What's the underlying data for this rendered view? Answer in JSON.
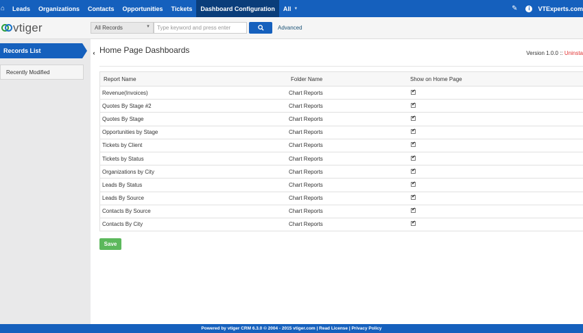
{
  "topnav": {
    "home_icon": "home-icon",
    "items": [
      {
        "label": "Leads"
      },
      {
        "label": "Organizations"
      },
      {
        "label": "Contacts"
      },
      {
        "label": "Opportunities"
      },
      {
        "label": "Tickets"
      },
      {
        "label": "Dashboard Configuration",
        "active": true
      },
      {
        "label": "All"
      }
    ],
    "user": "VTExperts.com",
    "accent": "#1560bd"
  },
  "header": {
    "logo_text": "vtiger",
    "filter_select": "All Records",
    "search_placeholder": "Type keyword and press enter",
    "advanced_label": "Advanced"
  },
  "sidebar": {
    "records_list": "Records List",
    "recently_modified": "Recently Modified"
  },
  "main": {
    "title": "Home Page Dashboards",
    "version_label": "Version 1.0.0 ::",
    "uninstall_label": "Uninsta",
    "table": {
      "headers": [
        "Report Name",
        "Folder Name",
        "Show on Home Page"
      ],
      "rows": [
        {
          "report": "Revenue(Invoices)",
          "folder": "Chart Reports",
          "show": true
        },
        {
          "report": "Quotes By Stage #2",
          "folder": "Chart Reports",
          "show": true
        },
        {
          "report": "Quotes By Stage",
          "folder": "Chart Reports",
          "show": true
        },
        {
          "report": "Opportunities by Stage",
          "folder": "Chart Reports",
          "show": true
        },
        {
          "report": "Tickets by Client",
          "folder": "Chart Reports",
          "show": true
        },
        {
          "report": "Tickets by Status",
          "folder": "Chart Reports",
          "show": true
        },
        {
          "report": "Organizations by City",
          "folder": "Chart Reports",
          "show": true
        },
        {
          "report": "Leads By Status",
          "folder": "Chart Reports",
          "show": true
        },
        {
          "report": "Leads By Source",
          "folder": "Chart Reports",
          "show": true
        },
        {
          "report": "Contacts By Source",
          "folder": "Chart Reports",
          "show": true
        },
        {
          "report": "Contacts By City",
          "folder": "Chart Reports",
          "show": true
        }
      ]
    },
    "save_label": "Save"
  },
  "footer": {
    "text": "Powered by vtiger CRM 6.3.0  © 2004 - 2015  vtiger.com | Read License | Privacy Policy"
  }
}
